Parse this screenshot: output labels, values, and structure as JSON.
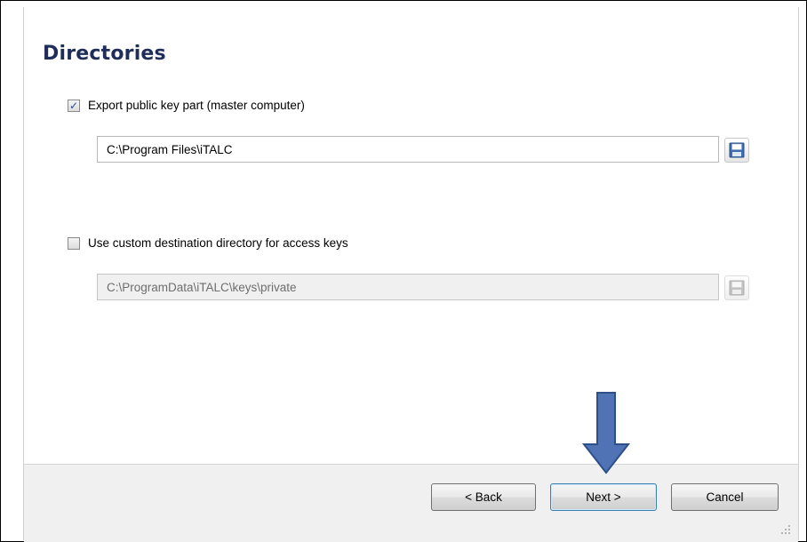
{
  "wizard": {
    "title": "Directories"
  },
  "export_public_key": {
    "label": "Export public key part (master computer)",
    "checked": true,
    "path": "C:\\Program Files\\iTALC",
    "browse_icon": "floppy-disk-icon"
  },
  "custom_destination": {
    "label": "Use custom destination directory for access keys",
    "checked": false,
    "path": "C:\\ProgramData\\iTALC\\keys\\private",
    "browse_icon": "floppy-disk-icon"
  },
  "buttons": {
    "back": "< Back",
    "next": "Next >",
    "cancel": "Cancel"
  },
  "annotation": {
    "arrow_icon": "down-arrow-icon",
    "arrow_color": "#4f73b4"
  },
  "colors": {
    "title": "#1f2d5a",
    "footer_bg": "#f0f0f0",
    "default_button_border": "#3c7fb1"
  }
}
